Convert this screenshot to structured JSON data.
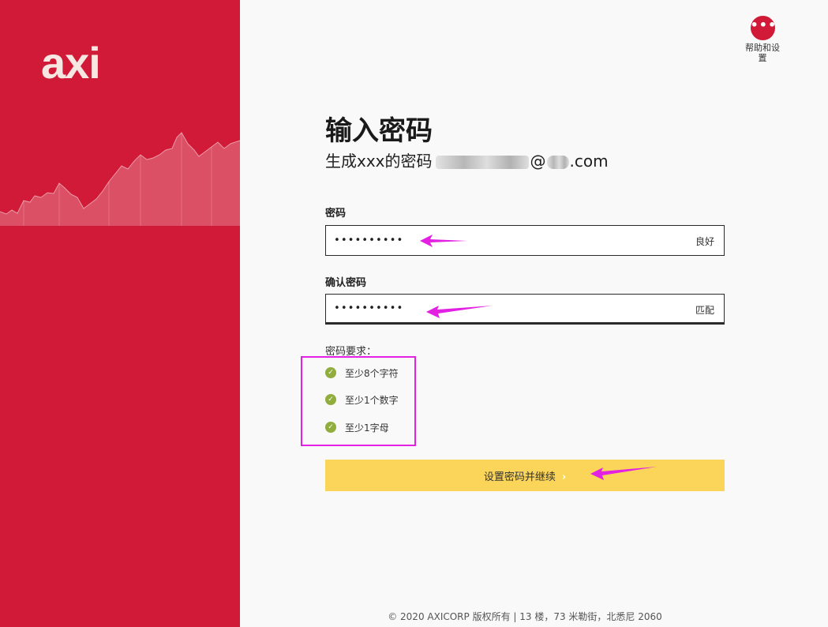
{
  "brand": {
    "logo_text": "axi",
    "accent_color": "#d11a37",
    "button_color": "#fbd559"
  },
  "help": {
    "icon_label": "•••",
    "label": "帮助和设置"
  },
  "header": {
    "title": "输入密码",
    "subtitle_prefix": "生成xxx的密码",
    "subtitle_at": "@",
    "subtitle_suffix": ".com"
  },
  "password": {
    "label": "密码",
    "value": "••••••••••",
    "status": "良好"
  },
  "confirm": {
    "label": "确认密码",
    "value": "••••••••••",
    "status": "匹配"
  },
  "requirements": {
    "title": "密码要求：",
    "items": [
      {
        "label": "至少8个字符",
        "met": true
      },
      {
        "label": "至少1个数字",
        "met": true
      },
      {
        "label": "至少1字母",
        "met": true
      }
    ]
  },
  "submit": {
    "label": "设置密码并继续",
    "chevron": "›"
  },
  "footer": {
    "text": "© 2020 AXICORP 版权所有 | 13 楼，73 米勒街，北悉尼 2060"
  },
  "icons": {
    "help": "more-dots-icon",
    "check": "check-circle-icon",
    "chevron": "chevron-right-icon",
    "annotation": "arrow-annotation-icon"
  }
}
